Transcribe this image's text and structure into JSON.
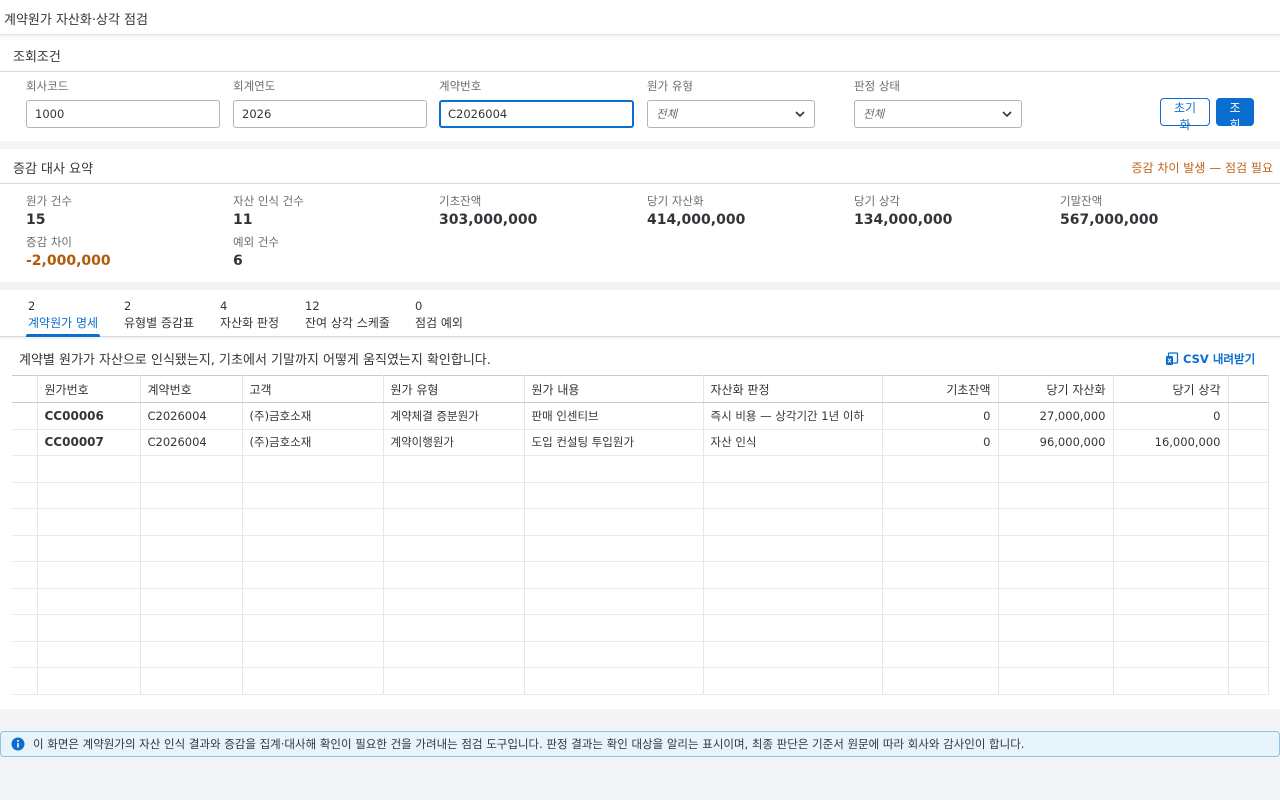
{
  "page": {
    "title": "계약원가 자산화·상각 점검"
  },
  "filter": {
    "title": "조회조건",
    "company_code": {
      "label": "회사코드",
      "value": "1000"
    },
    "fiscal_year": {
      "label": "회계연도",
      "value": "2026"
    },
    "contract_no": {
      "label": "계약번호",
      "value": "C2026004"
    },
    "cost_type": {
      "label": "원가 유형",
      "value": "전체"
    },
    "judgment_status": {
      "label": "판정 상태",
      "value": "전체"
    },
    "reset_label": "초기화",
    "search_label": "조회"
  },
  "summary": {
    "title": "증감 대사 요약",
    "warning": "증감 차이 발생 — 점검 필요",
    "metrics": [
      {
        "label": "원가 건수",
        "value": "15"
      },
      {
        "label": "자산 인식 건수",
        "value": "11"
      },
      {
        "label": "기초잔액",
        "value": "303,000,000"
      },
      {
        "label": "당기 자산화",
        "value": "414,000,000"
      },
      {
        "label": "당기 상각",
        "value": "134,000,000"
      },
      {
        "label": "기말잔액",
        "value": "567,000,000"
      },
      {
        "label": "증감 차이",
        "value": "-2,000,000"
      },
      {
        "label": "예외 건수",
        "value": "6"
      }
    ]
  },
  "tabs": [
    {
      "count": "2",
      "label": "계약원가 명세"
    },
    {
      "count": "2",
      "label": "유형별 증감표"
    },
    {
      "count": "4",
      "label": "자산화 판정"
    },
    {
      "count": "12",
      "label": "잔여 상각 스케줄"
    },
    {
      "count": "0",
      "label": "점검 예외"
    }
  ],
  "content": {
    "description": "계약별 원가가 자산으로 인식됐는지, 기초에서 기말까지 어떻게 움직였는지 확인합니다.",
    "csv_label": "CSV 내려받기",
    "columns": [
      "원가번호",
      "계약번호",
      "고객",
      "원가 유형",
      "원가 내용",
      "자산화 판정",
      "기초잔액",
      "당기 자산화",
      "당기 상각"
    ],
    "rows": [
      [
        "CC00006",
        "C2026004",
        "(주)금호소재",
        "계약체결 증분원가",
        "판매 인센티브",
        "즉시 비용 — 상각기간 1년 이하",
        "0",
        "27,000,000",
        "0"
      ],
      [
        "CC00007",
        "C2026004",
        "(주)금호소재",
        "계약이행원가",
        "도입 컨설팅 투입원가",
        "자산 인식",
        "0",
        "96,000,000",
        "16,000,000"
      ]
    ]
  },
  "info": {
    "icon": "info-icon",
    "text": "이 화면은 계약원가의 자산 인식 결과와 증감을 집계·대사해 확인이 필요한 건을 가려내는 점검 도구입니다. 판정 결과는 확인 대상을 알리는 표시이며, 최종 판단은 기준서 원문에 따라 회사와 감사인이 합니다."
  },
  "colors": {
    "accent": "#0a6ed1",
    "warning": "#c0661a",
    "negative": "#b05a0a"
  }
}
